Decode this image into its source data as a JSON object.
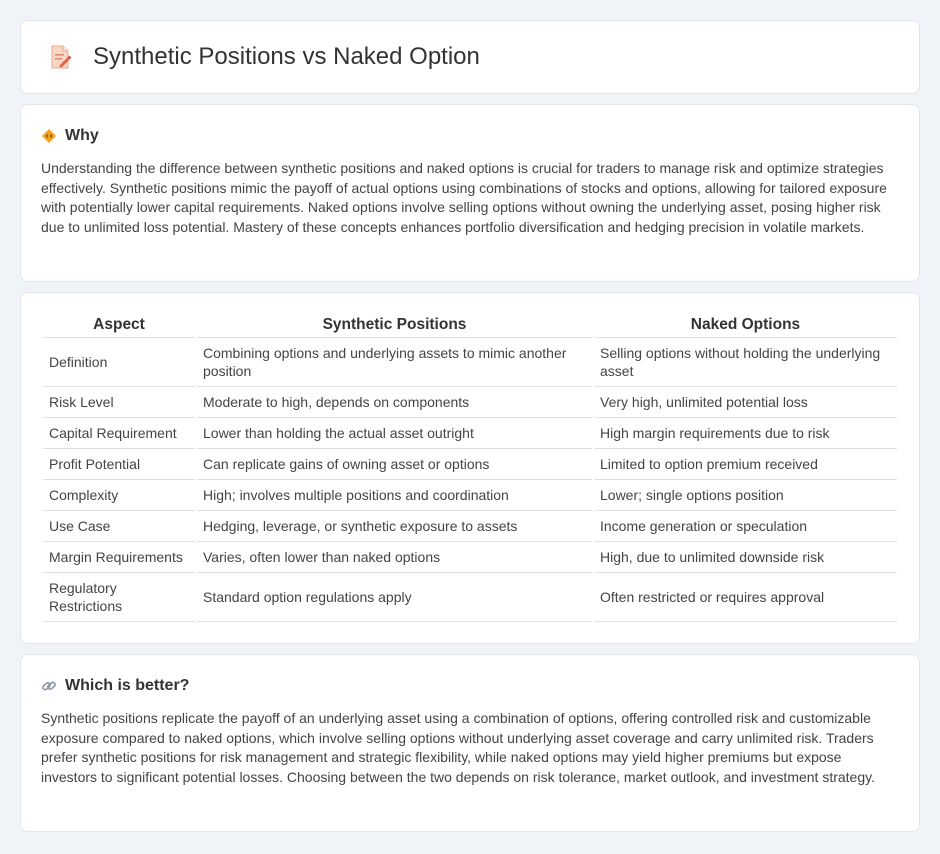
{
  "header": {
    "title": "Synthetic Positions vs Naked Option",
    "icon": "document-pencil-icon"
  },
  "why": {
    "title": "Why",
    "icon": "diamond-sign-icon",
    "text": "Understanding the difference between synthetic positions and naked options is crucial for traders to manage risk and optimize strategies effectively. Synthetic positions mimic the payoff of actual options using combinations of stocks and options, allowing for tailored exposure with potentially lower capital requirements. Naked options involve selling options without owning the underlying asset, posing higher risk due to unlimited loss potential. Mastery of these concepts enhances portfolio diversification and hedging precision in volatile markets."
  },
  "table": {
    "headers": [
      "Aspect",
      "Synthetic Positions",
      "Naked Options"
    ],
    "rows": [
      [
        "Definition",
        "Combining options and underlying assets to mimic another position",
        "Selling options without holding the underlying asset"
      ],
      [
        "Risk Level",
        "Moderate to high, depends on components",
        "Very high, unlimited potential loss"
      ],
      [
        "Capital Requirement",
        "Lower than holding the actual asset outright",
        "High margin requirements due to risk"
      ],
      [
        "Profit Potential",
        "Can replicate gains of owning asset or options",
        "Limited to option premium received"
      ],
      [
        "Complexity",
        "High; involves multiple positions and coordination",
        "Lower; single options position"
      ],
      [
        "Use Case",
        "Hedging, leverage, or synthetic exposure to assets",
        "Income generation or speculation"
      ],
      [
        "Margin Requirements",
        "Varies, often lower than naked options",
        "High, due to unlimited downside risk"
      ],
      [
        "Regulatory Restrictions",
        "Standard option regulations apply",
        "Often restricted or requires approval"
      ]
    ]
  },
  "better": {
    "title": "Which is better?",
    "icon": "link-icon",
    "text": "Synthetic positions replicate the payoff of an underlying asset using a combination of options, offering controlled risk and customizable exposure compared to naked options, which involve selling options without underlying asset coverage and carry unlimited risk. Traders prefer synthetic positions for risk management and strategic flexibility, while naked options may yield higher premiums but expose investors to significant potential losses. Choosing between the two depends on risk tolerance, market outlook, and investment strategy."
  }
}
